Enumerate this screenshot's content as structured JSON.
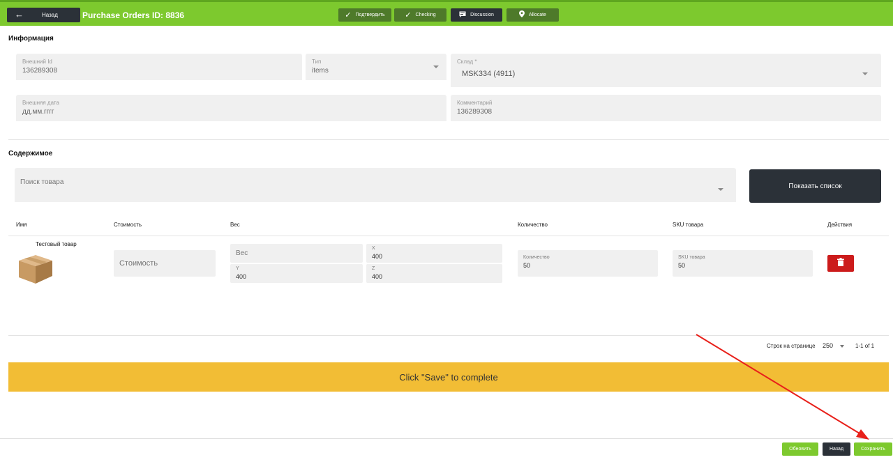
{
  "header": {
    "back_label": "Назад",
    "title": "Purchase Orders ID: 8836",
    "actions": [
      {
        "label": "Подтвердить",
        "icon": "check-icon"
      },
      {
        "label": "Checking",
        "icon": "check-icon"
      },
      {
        "label": "Discussion",
        "icon": "message-icon"
      },
      {
        "label": "Allocate",
        "icon": "location-pin-icon"
      }
    ]
  },
  "info": {
    "title": "Информация",
    "external_id": {
      "label": "Внешний Id",
      "value": "136289308"
    },
    "type": {
      "label": "Тип",
      "value": "items"
    },
    "warehouse": {
      "label": "Склад *",
      "value": "MSK334 (4911)"
    },
    "external_date": {
      "label": "Внешняя дата",
      "value": "дд.мм.гггг"
    },
    "comment": {
      "label": "Комментарий",
      "value": "136289308"
    }
  },
  "contents": {
    "title": "Содержимое",
    "search_placeholder": "Поиск товара",
    "show_list_label": "Показать список",
    "columns": [
      "Имя",
      "Стоимость",
      "Вес",
      "Количество",
      "SKU товара",
      "Действия"
    ],
    "row": {
      "name": "Тестовый товар",
      "cost_placeholder": "Стоимость",
      "weight_placeholder": "Вес",
      "x_label": "X",
      "x_value": "400",
      "y_label": "Y",
      "y_value": "400",
      "z_label": "Z",
      "z_value": "400",
      "qty_label": "Количество",
      "qty_value": "50",
      "sku_label": "SKU товара",
      "sku_value": "50"
    }
  },
  "pagination": {
    "rows_label": "Строк на странице",
    "rows_value": "250",
    "range": "1-1 of 1"
  },
  "banner": "Click \"Save\" to complete",
  "footer": {
    "refresh_label": "Обновить",
    "back_label": "Назад",
    "save_label": "Сохранить"
  },
  "colors": {
    "brand_green": "#7dc92e",
    "dark": "#2b3138",
    "banner_yellow": "#f2bd35",
    "danger_red": "#cc1b1b"
  }
}
